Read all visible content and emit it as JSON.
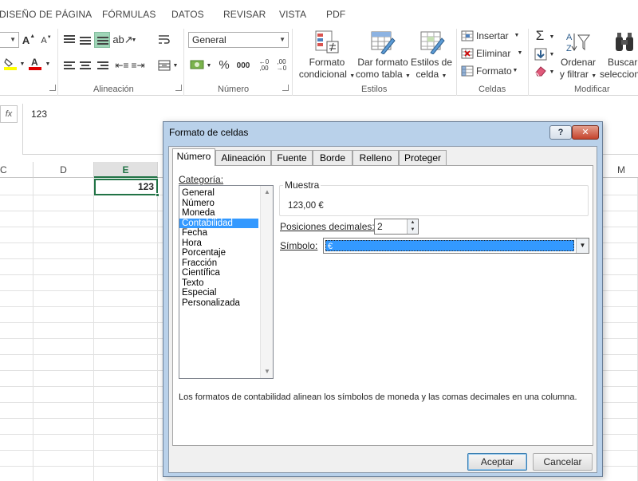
{
  "ribbon_tabs": [
    "DISEÑO DE PÁGINA",
    "FÓRMULAS",
    "DATOS",
    "REVISAR",
    "VISTA",
    "PDF"
  ],
  "ribbon": {
    "groups": {
      "alignment": "Alineación",
      "number": "Número",
      "styles": "Estilos",
      "cells": "Celdas",
      "modify": "Modificar"
    },
    "number_format_value": "General",
    "currency_symbol": "%",
    "thousands": "000",
    "styles": {
      "conditional_line1": "Formato",
      "conditional_line2": "condicional",
      "table_line1": "Dar formato",
      "table_line2": "como tabla",
      "cell_styles_line1": "Estilos de",
      "cell_styles_line2": "celda"
    },
    "cells": {
      "insert": "Insertar",
      "delete": "Eliminar",
      "format": "Formato"
    },
    "modify": {
      "sort_line1": "Ordenar",
      "sort_line2": "y filtrar",
      "find_line1": "Buscar",
      "find_line2": "selecciona"
    }
  },
  "formula_bar": {
    "fx": "fx",
    "value": "123"
  },
  "sheet": {
    "columns": [
      "C",
      "D",
      "E",
      "M"
    ],
    "active_column": "E",
    "active_cell_value": "123"
  },
  "dialog": {
    "title": "Formato de celdas",
    "help": "?",
    "close": "✕",
    "tabs": [
      "Número",
      "Alineación",
      "Fuente",
      "Borde",
      "Relleno",
      "Proteger"
    ],
    "active_tab": "Número",
    "category_label": "Categoría:",
    "categories": [
      "General",
      "Número",
      "Moneda",
      "Contabilidad",
      "Fecha",
      "Hora",
      "Porcentaje",
      "Fracción",
      "Científica",
      "Texto",
      "Especial",
      "Personalizada"
    ],
    "selected_category": "Contabilidad",
    "sample_legend": "Muestra",
    "sample_value": "123,00 €",
    "decimals_label": "Posiciones decimales:",
    "decimals_value": "2",
    "symbol_label": "Símbolo:",
    "symbol_value": "€",
    "description": "Los formatos de contabilidad alinean los símbolos de moneda y las comas decimales en una columna.",
    "ok": "Aceptar",
    "cancel": "Cancelar"
  },
  "colors": {
    "excel_green": "#217346",
    "selection_blue": "#3399ff",
    "dialog_frame": "#b9d1ea",
    "close_red": "#c5432c"
  }
}
